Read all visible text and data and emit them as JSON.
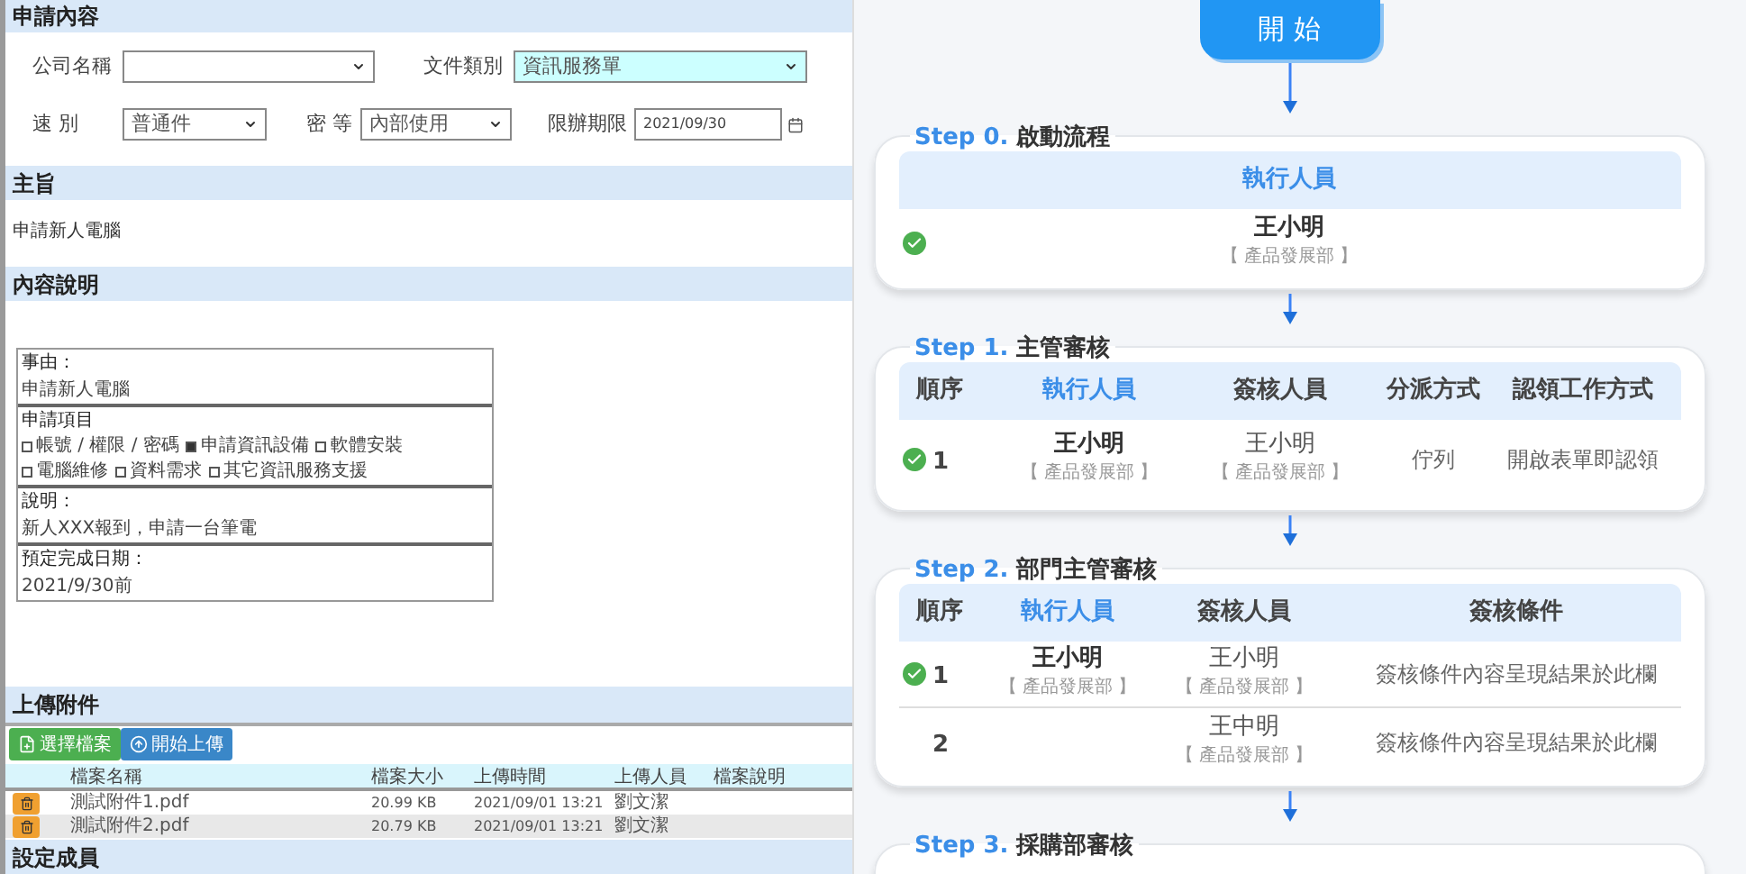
{
  "application": {
    "title": "申請內容",
    "fields": [
      {
        "label": "公司名稱",
        "kind": "select",
        "highlighted": false
      },
      {
        "label": "文件類別",
        "kind": "select",
        "value": "資訊服務單",
        "highlighted": true
      },
      {
        "label": "速 別",
        "kind": "select",
        "value": "普通件",
        "highlighted": false
      },
      {
        "label": "密 等",
        "kind": "select",
        "value": "內部使用",
        "highlighted": false
      },
      {
        "label": "限辦期限",
        "kind": "date",
        "value": "2021/09/30",
        "highlighted": false
      }
    ]
  },
  "subject": {
    "title": "主旨",
    "text": "申請新人電腦"
  },
  "description": {
    "title": "內容說明",
    "cells": [
      {
        "label": "事由：",
        "lines": [
          "申請新人電腦"
        ]
      },
      {
        "label": "申請項目",
        "option_rows": [
          [
            {
              "label": "帳號 / 權限 / 密碼",
              "checked": false
            },
            {
              "label": "申請資訊設備",
              "checked": true
            },
            {
              "label": "軟體安裝",
              "checked": false
            }
          ],
          [
            {
              "label": "電腦維修",
              "checked": false
            },
            {
              "label": "資料需求",
              "checked": false
            },
            {
              "label": "其它資訊服務支援",
              "checked": false
            }
          ]
        ]
      },
      {
        "label": "說明：",
        "lines": [
          "新人XXX報到，申請一台筆電"
        ]
      },
      {
        "label": "預定完成日期：",
        "lines": [
          "2021/9/30前"
        ]
      }
    ]
  },
  "attachments": {
    "title": "上傳附件",
    "buttons": [
      {
        "label": "選擇檔案",
        "kind": "choose"
      },
      {
        "label": "開始上傳",
        "kind": "upload"
      }
    ],
    "columns": [
      "檔案名稱",
      "檔案大小",
      "上傳時間",
      "上傳人員",
      "檔案說明"
    ],
    "rows": [
      {
        "name": "測試附件1.pdf",
        "size": "20.99 KB",
        "time": "2021/09/01 13:21",
        "uploader": "劉文潔"
      },
      {
        "name": "測試附件2.pdf",
        "size": "20.79 KB",
        "time": "2021/09/01 13:21",
        "uploader": "劉文潔"
      }
    ]
  },
  "members": {
    "title": "設定成員"
  },
  "flow": {
    "start": "開 始",
    "steps": [
      {
        "number": "Step 0.",
        "title": "啟動流程",
        "columns": [
          {
            "label": "執行人員",
            "highlighted": true
          }
        ],
        "rows": [
          {
            "done": true,
            "cells": [
              {
                "kind": "person",
                "name": "王小明",
                "dept": "【 產品發展部 】"
              }
            ]
          }
        ]
      },
      {
        "number": "Step 1.",
        "title": "主管審核",
        "columns": [
          {
            "label": "順序",
            "highlighted": false
          },
          {
            "label": "執行人員",
            "highlighted": true
          },
          {
            "label": "簽核人員",
            "highlighted": false
          },
          {
            "label": "分派方式",
            "highlighted": false
          },
          {
            "label": "認領工作方式",
            "highlighted": false
          }
        ],
        "rows": [
          {
            "done": true,
            "cells": [
              {
                "kind": "order",
                "text": "1"
              },
              {
                "kind": "person",
                "name": "王小明",
                "dept": "【 產品發展部 】"
              },
              {
                "kind": "person",
                "name": "王小明",
                "dept": "【 產品發展部 】"
              },
              {
                "kind": "text",
                "text": "佇列"
              },
              {
                "kind": "text",
                "text": "開啟表單即認領"
              }
            ]
          }
        ]
      },
      {
        "number": "Step 2.",
        "title": "部門主管審核",
        "columns": [
          {
            "label": "順序",
            "highlighted": false
          },
          {
            "label": "執行人員",
            "highlighted": true
          },
          {
            "label": "簽核人員",
            "highlighted": false
          },
          {
            "label": "簽核條件",
            "highlighted": false
          }
        ],
        "rows": [
          {
            "done": true,
            "cells": [
              {
                "kind": "order",
                "text": "1"
              },
              {
                "kind": "person",
                "name": "王小明",
                "dept": "【 產品發展部 】"
              },
              {
                "kind": "person",
                "name": "王小明",
                "dept": "【 產品發展部 】"
              },
              {
                "kind": "text",
                "text": "簽核條件內容呈現結果於此欄"
              }
            ]
          },
          {
            "done": false,
            "cells": [
              {
                "kind": "order",
                "text": "2"
              },
              {
                "kind": "blank"
              },
              {
                "kind": "person",
                "name": "王中明",
                "dept": "【 產品發展部 】"
              },
              {
                "kind": "text",
                "text": "簽核條件內容呈現結果於此欄"
              }
            ]
          }
        ]
      },
      {
        "number": "Step 3.",
        "title": "採購部審核"
      }
    ]
  }
}
